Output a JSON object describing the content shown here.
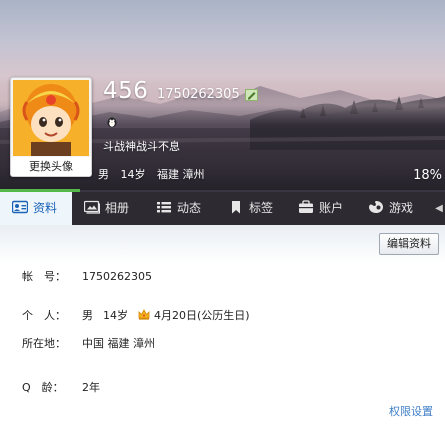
{
  "profile": {
    "nickname": "456",
    "qq_number": "1750262305",
    "signature": "斗战神战斗不息",
    "gender": "男",
    "age": "14岁",
    "location": "福建 漳州",
    "completeness": "18%",
    "change_avatar_label": "更换头像",
    "completeness_fraction": 0.18
  },
  "tabs": [
    {
      "label": "资料",
      "icon": "id-card-icon",
      "active": true
    },
    {
      "label": "相册",
      "icon": "photo-album-icon",
      "active": false
    },
    {
      "label": "动态",
      "icon": "feed-list-icon",
      "active": false
    },
    {
      "label": "标签",
      "icon": "bookmark-icon",
      "active": false
    },
    {
      "label": "账户",
      "icon": "wallet-icon",
      "active": false
    },
    {
      "label": "游戏",
      "icon": "game-icon",
      "active": false
    }
  ],
  "details": {
    "edit_button": "编辑资料",
    "account_label": "帐　号：",
    "account_value": "1750262305",
    "personal_label": "个　人：",
    "personal_gender": "男",
    "personal_age": "14岁",
    "birthday": "4月20日(公历生日)",
    "location_label": "所在地：",
    "location_value": "中国 福建 漳州",
    "qage_label": "Q　龄：",
    "qage_value": "2年",
    "permission_link": "权限设置"
  },
  "colors": {
    "accent": "#1a63b5",
    "link": "#3f7fc8",
    "tab_bar": "#2e2a32",
    "progress": "#55b84a"
  }
}
